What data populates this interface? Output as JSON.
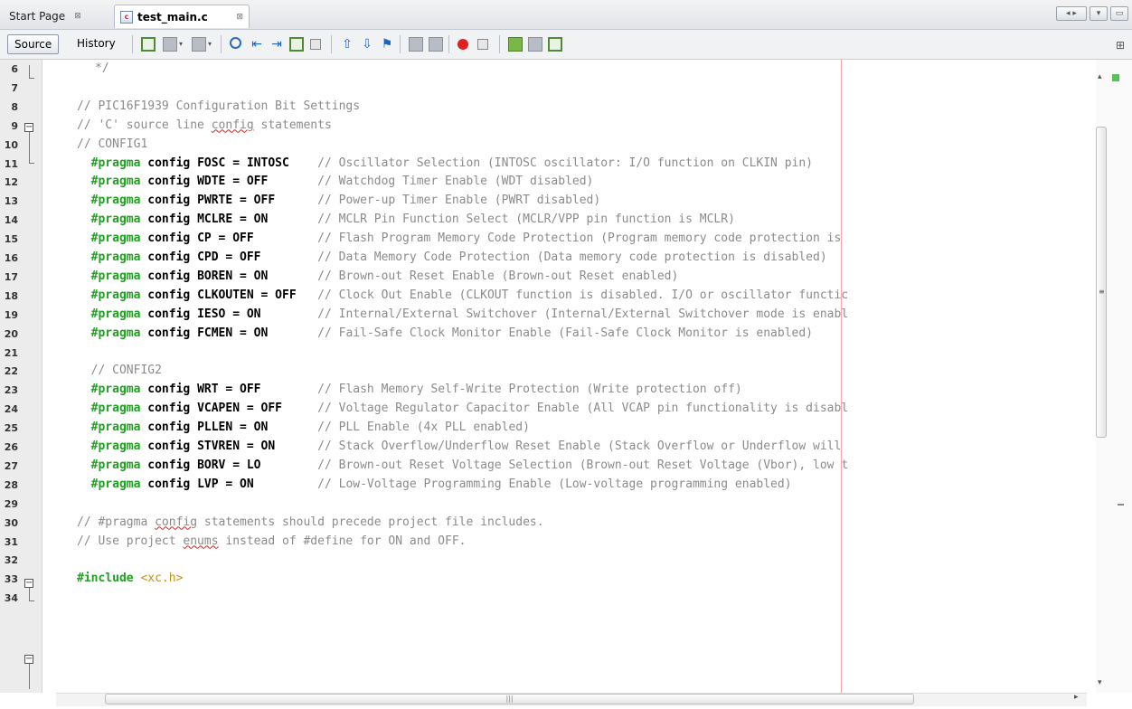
{
  "tabs": [
    {
      "label": "Start Page"
    },
    {
      "label": "test_main.c"
    }
  ],
  "toolbar": {
    "source_label": "Source",
    "history_label": "History"
  },
  "editor": {
    "lines": [
      {
        "n": "6",
        "parts": [
          [
            "cm",
            "*/"
          ]
        ]
      },
      {
        "n": "7",
        "parts": []
      },
      {
        "n": "8",
        "parts": [
          [
            "cm",
            "// PIC16F1939 Configuration Bit Settings"
          ]
        ]
      },
      {
        "n": "9",
        "parts": [
          [
            "cm",
            "// 'C' source line "
          ],
          [
            "cm sq",
            "config"
          ],
          [
            "cm",
            " statements"
          ]
        ]
      },
      {
        "n": "10",
        "parts": [
          [
            "cm",
            "// CONFIG1"
          ]
        ]
      },
      {
        "n": "11",
        "parts": [
          [
            "pp",
            "  #pragma"
          ],
          [
            "kw",
            " config FOSC = INTOSC"
          ],
          [
            "",
            "    "
          ],
          [
            "cm",
            "// Oscillator Selection (INTOSC oscillator: I/O function on CLKIN pin)"
          ]
        ]
      },
      {
        "n": "12",
        "parts": [
          [
            "pp",
            "  #pragma"
          ],
          [
            "kw",
            " config WDTE = OFF"
          ],
          [
            "",
            "       "
          ],
          [
            "cm",
            "// Watchdog Timer Enable (WDT disabled)"
          ]
        ]
      },
      {
        "n": "13",
        "parts": [
          [
            "pp",
            "  #pragma"
          ],
          [
            "kw",
            " config PWRTE = OFF"
          ],
          [
            "",
            "      "
          ],
          [
            "cm",
            "// Power-up Timer Enable (PWRT disabled)"
          ]
        ]
      },
      {
        "n": "14",
        "parts": [
          [
            "pp",
            "  #pragma"
          ],
          [
            "kw",
            " config MCLRE = ON"
          ],
          [
            "",
            "       "
          ],
          [
            "cm",
            "// MCLR Pin Function Select (MCLR/VPP pin function is MCLR)"
          ]
        ]
      },
      {
        "n": "15",
        "parts": [
          [
            "pp",
            "  #pragma"
          ],
          [
            "kw",
            " config CP = OFF"
          ],
          [
            "",
            "         "
          ],
          [
            "cm",
            "// Flash Program Memory Code Protection (Program memory code protection is"
          ]
        ]
      },
      {
        "n": "16",
        "parts": [
          [
            "pp",
            "  #pragma"
          ],
          [
            "kw",
            " config CPD = OFF"
          ],
          [
            "",
            "        "
          ],
          [
            "cm",
            "// Data Memory Code Protection (Data memory code protection is disabled)"
          ]
        ]
      },
      {
        "n": "17",
        "parts": [
          [
            "pp",
            "  #pragma"
          ],
          [
            "kw",
            " config BOREN = ON"
          ],
          [
            "",
            "       "
          ],
          [
            "cm",
            "// Brown-out Reset Enable (Brown-out Reset enabled)"
          ]
        ]
      },
      {
        "n": "18",
        "parts": [
          [
            "pp",
            "  #pragma"
          ],
          [
            "kw",
            " config CLKOUTEN = OFF"
          ],
          [
            "",
            "   "
          ],
          [
            "cm",
            "// Clock Out Enable (CLKOUT function is disabled. I/O or oscillator functic"
          ]
        ]
      },
      {
        "n": "19",
        "parts": [
          [
            "pp",
            "  #pragma"
          ],
          [
            "kw",
            " config IESO = ON"
          ],
          [
            "",
            "        "
          ],
          [
            "cm",
            "// Internal/External Switchover (Internal/External Switchover mode is enabl"
          ]
        ]
      },
      {
        "n": "20",
        "parts": [
          [
            "pp",
            "  #pragma"
          ],
          [
            "kw",
            " config FCMEN = ON"
          ],
          [
            "",
            "       "
          ],
          [
            "cm",
            "// Fail-Safe Clock Monitor Enable (Fail-Safe Clock Monitor is enabled)"
          ]
        ]
      },
      {
        "n": "21",
        "parts": []
      },
      {
        "n": "22",
        "parts": [
          [
            "cm",
            "  // CONFIG2"
          ]
        ]
      },
      {
        "n": "23",
        "parts": [
          [
            "pp",
            "  #pragma"
          ],
          [
            "kw",
            " config WRT = OFF"
          ],
          [
            "",
            "        "
          ],
          [
            "cm",
            "// Flash Memory Self-Write Protection (Write protection off)"
          ]
        ]
      },
      {
        "n": "24",
        "parts": [
          [
            "pp",
            "  #pragma"
          ],
          [
            "kw",
            " config VCAPEN = OFF"
          ],
          [
            "",
            "     "
          ],
          [
            "cm",
            "// Voltage Regulator Capacitor Enable (All VCAP pin functionality is disabl"
          ]
        ]
      },
      {
        "n": "25",
        "parts": [
          [
            "pp",
            "  #pragma"
          ],
          [
            "kw",
            " config PLLEN = ON"
          ],
          [
            "",
            "       "
          ],
          [
            "cm",
            "// PLL Enable (4x PLL enabled)"
          ]
        ]
      },
      {
        "n": "26",
        "parts": [
          [
            "pp",
            "  #pragma"
          ],
          [
            "kw",
            " config STVREN = ON"
          ],
          [
            "",
            "      "
          ],
          [
            "cm",
            "// Stack Overflow/Underflow Reset Enable (Stack Overflow or Underflow will"
          ]
        ]
      },
      {
        "n": "27",
        "parts": [
          [
            "pp",
            "  #pragma"
          ],
          [
            "kw",
            " config BORV = LO"
          ],
          [
            "",
            "        "
          ],
          [
            "cm",
            "// Brown-out Reset Voltage Selection (Brown-out Reset Voltage (Vbor), low t"
          ]
        ]
      },
      {
        "n": "28",
        "parts": [
          [
            "pp",
            "  #pragma"
          ],
          [
            "kw",
            " config LVP = ON"
          ],
          [
            "",
            "         "
          ],
          [
            "cm",
            "// Low-Voltage Programming Enable (Low-voltage programming enabled)"
          ]
        ]
      },
      {
        "n": "29",
        "parts": []
      },
      {
        "n": "30",
        "parts": [
          [
            "cm",
            "// #pragma "
          ],
          [
            "cm sq",
            "config"
          ],
          [
            "cm",
            " statements should precede project file includes."
          ]
        ]
      },
      {
        "n": "31",
        "parts": [
          [
            "cm",
            "// Use project "
          ],
          [
            "cm sq",
            "enums"
          ],
          [
            "cm",
            " instead of #define for ON and OFF."
          ]
        ]
      },
      {
        "n": "32",
        "parts": []
      },
      {
        "n": "33",
        "parts": [
          [
            "pp",
            "#include"
          ],
          [
            "",
            " "
          ],
          [
            "inc",
            "<xc.h>"
          ]
        ]
      },
      {
        "n": "34",
        "parts": []
      }
    ]
  },
  "colors": {
    "preprocessor": "#20a020",
    "comment": "#8b8b8b",
    "include": "#c8921a",
    "margin_line": "#f2a3a3"
  }
}
